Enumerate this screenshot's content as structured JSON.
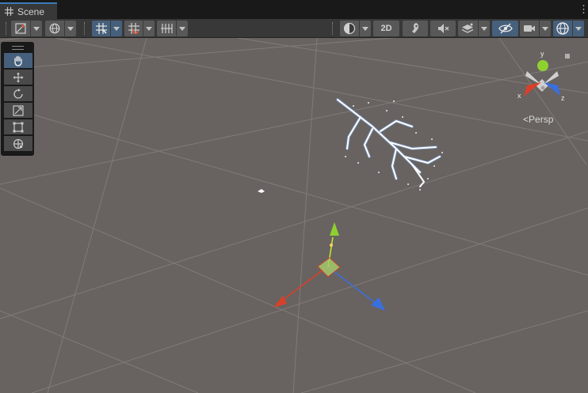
{
  "window": {
    "tab_label": "Scene",
    "more_icon": "kebab-menu-icon"
  },
  "toolbar": {
    "draw_mode_icon": "shading-mode-icon",
    "global_icon": "global-sphere-icon",
    "grid_snap_icon": "grid-snap-icon",
    "increment_snap_icon": "increment-snap-icon",
    "grid_visibility_icon": "grid-visibility-icon",
    "render_mode_icon": "shaded-sphere-icon",
    "mode_2d_label": "2D",
    "lighting_icon": "lighting-icon",
    "audio_icon": "audio-mute-icon",
    "effects_icon": "effects-layers-icon",
    "hidden_icon": "scene-visibility-icon",
    "camera_icon": "camera-icon",
    "gizmos_icon": "gizmos-icon"
  },
  "tools": [
    {
      "name": "hand-tool",
      "icon": "hand-icon",
      "active": true
    },
    {
      "name": "move-tool",
      "icon": "move-arrows-icon",
      "active": false
    },
    {
      "name": "rotate-tool",
      "icon": "rotate-icon",
      "active": false
    },
    {
      "name": "scale-tool",
      "icon": "scale-icon",
      "active": false
    },
    {
      "name": "rect-tool",
      "icon": "rect-icon",
      "active": false
    },
    {
      "name": "transform-tool",
      "icon": "transform-icon",
      "active": false
    }
  ],
  "gizmo": {
    "axis_x_label": "x",
    "axis_y_label": "y",
    "axis_z_label": "z",
    "projection_label": "Persp",
    "colors": {
      "x": "#d8402a",
      "y": "#8fd030",
      "z": "#3a6fe0"
    }
  },
  "scene": {
    "background_color": "#686360",
    "grid_color": "#8a8582"
  }
}
